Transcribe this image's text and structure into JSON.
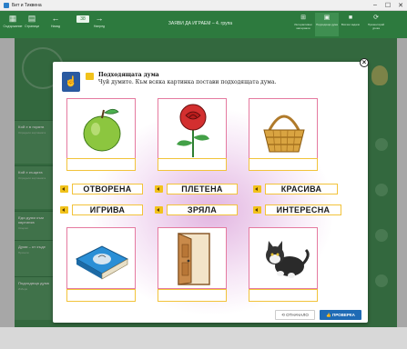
{
  "window": {
    "title": "Бит и Тиквена",
    "minimize": "–",
    "maximize": "☐",
    "close": "✕"
  },
  "toolbar": {
    "left_buttons": [
      {
        "label": "Съдържание",
        "icon": "grid-icon"
      },
      {
        "label": "Страници",
        "icon": "pages-icon"
      },
      {
        "label": "Назад",
        "icon": "back-arrow-icon"
      },
      {
        "label": "Напред",
        "icon": "forward-arrow-icon"
      }
    ],
    "page_number": "38",
    "center_title": "ЗАЯВИ ДА ИГРАЕМ – 4. група",
    "right_buttons": [
      {
        "label": "Интерактивни материали",
        "icon": "interactive-icon"
      },
      {
        "label": "Подходяща дума",
        "icon": "exercise-icon"
      },
      {
        "label": "Всички задачи",
        "icon": "folder-icon"
      },
      {
        "label": "Презентирай урока",
        "icon": "refresh-icon"
      }
    ]
  },
  "background_cards": [
    {
      "title": "Кой е в гората",
      "sub": "Определи картинката"
    },
    {
      "title": "Кой е къщата",
      "sub": "Определи картинката"
    },
    {
      "title": "Еди думи към картинка",
      "sub": "Свържи"
    },
    {
      "title": "Думи – от къде",
      "sub": "Прочети"
    },
    {
      "title": "Подходяща дума",
      "sub": "Избери"
    }
  ],
  "dialog": {
    "title": "Подходящата дума",
    "subtitle": "Чуй думите. Към всяка картинка постави подходящата дума.",
    "close_label": "×",
    "images": [
      {
        "name": "apple-image",
        "slot": ""
      },
      {
        "name": "rose-image",
        "slot": ""
      },
      {
        "name": "basket-image",
        "slot": ""
      },
      {
        "name": "book-image",
        "slot": ""
      },
      {
        "name": "door-image",
        "slot": ""
      },
      {
        "name": "kitten-image",
        "slot": ""
      }
    ],
    "words": [
      "ОТВОРЕНА",
      "ПЛЕТЕНА",
      "КРАСИВА",
      "ИГРИВА",
      "ЗРЯЛА",
      "ИНТЕРЕСНА"
    ],
    "reset_label": "⟲ ОТНАЧАЛО",
    "check_label": "👍 ПРОВЕРКА"
  }
}
